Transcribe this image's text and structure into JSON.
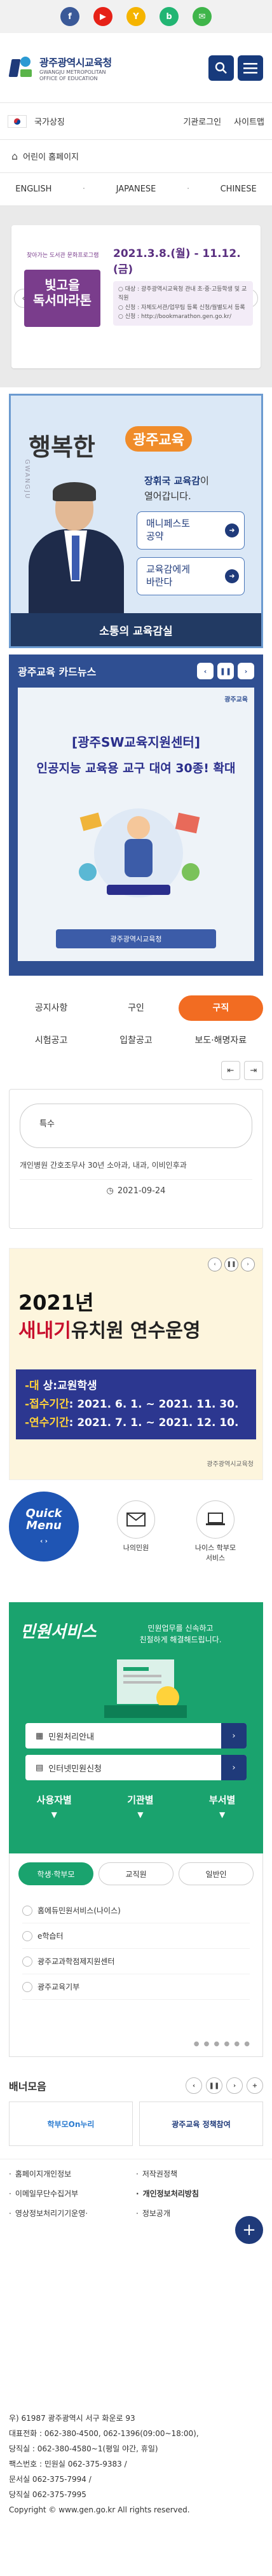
{
  "social": [
    "f",
    "▶",
    "Y",
    "b",
    "✉"
  ],
  "header": {
    "title_ko": "광주광역시교육청",
    "title_en1": "GWANGJU METROPOLITAN",
    "title_en2": "OFFICE OF EDUCATION"
  },
  "util": {
    "sites": "국가상징",
    "links": [
      "기관로그인",
      "사이트맵"
    ]
  },
  "kids": "어린이 홈페이지",
  "langs": [
    "ENGLISH",
    "JAPANESE",
    "CHINESE"
  ],
  "banner1": {
    "small": "찾아가는 도서관 문화프로그램",
    "title": "빛고을\n독서마라톤",
    "date": "2021.3.8.(월) - 11.12.(금)",
    "info": "○ 대상 : 광주광역시교육청 관내 초·중·고등학생 및 교직원\n○ 신청 : 자체도서관/업무팀 등록 신청/월별도서 등록\n○ 신청 : http://bookmarathon.gen.go.kr/"
  },
  "super": {
    "title": "행복한",
    "badge": "광주교육",
    "msg1": "장휘국 교육감",
    "msg2": "이",
    "msg3": "열어갑니다.",
    "btn1": "매니페스토\n공약",
    "btn2": "교육감에게\n바란다",
    "foot": "소통의 교육감실"
  },
  "cards": {
    "title": "광주교육 카드뉴스",
    "logo": "광주교육",
    "line1": "[광주SW교육지원센터]",
    "line2": "인공지능 교육용 교구 대여 30종! 확대",
    "ribbon": "광주광역시교육청"
  },
  "notice": {
    "tabs1": [
      "공지사항",
      "구인",
      "구직"
    ],
    "tabs2": [
      "시험공고",
      "입찰공고",
      "보도·해명자료"
    ],
    "tag": "특수",
    "text": "개인병원 간호조무사 30년 소아과, 내과, 이비인후과",
    "date": "2021-09-24"
  },
  "banner2": {
    "year": "2021년",
    "title_a": "새내기",
    "title_b": "유·",
    "title_c": "유치원 연수운영",
    "title_full": "새내기유치원 연수운영",
    "l1a": "-대",
    "l1b": "상:교원학생",
    "l2a": "-접수기간",
    "l2b": ": 2021. 6. 1. ~ 2021. 11. 30.",
    "l3a": "-연수기간",
    "l3b": ": 2021. 7. 1. ~ 2021. 12. 10.",
    "foot": "광주광역시교육청"
  },
  "quick": {
    "title1": "Quick",
    "title2": "Menu",
    "items": [
      "나의민원",
      "나이스 학부모\n서비스"
    ]
  },
  "civil": {
    "title": "민원서비스",
    "sub": "민원업무를 신속하고\n친절하게 해결해드립니다.",
    "btn1": "민원처리안내",
    "btn2": "인터넷민원신청",
    "cols": [
      "사용자별",
      "기관별",
      "부서별"
    ],
    "pills": [
      "학생·학부모",
      "교직원",
      "일반인"
    ],
    "list": [
      "홈에듀민원서비스(나이스)",
      "e학습터",
      "광주교과학점제지원센터",
      "광주교육기부"
    ]
  },
  "gallery": {
    "title": "배너모음",
    "logo1": "학부모On누리",
    "logo2": "광주교육 정책참여"
  },
  "links": [
    "홈페이지개인정보",
    "저작권정책",
    "이메일무단수집거부",
    "개인정보처리방침",
    "영상정보처리기기운영·",
    "정보공개"
  ],
  "footer": {
    "addr": "우) 61987 광주광역시 서구 화운로 93",
    "tel": "대표전화 : 062-380-4500, 062-1396(09:00~18:00),",
    "night": "당직실 : 062-380-4580~1(평일 야간, 휴일)",
    "fax": "팩스번호 : 민원실 062-375-9383 /",
    "fax2": "문서실 062-375-7994 /",
    "fax3": "당직실 062-375-7995",
    "copy": "Copyright © www.gen.go.kr All rights reserved."
  }
}
